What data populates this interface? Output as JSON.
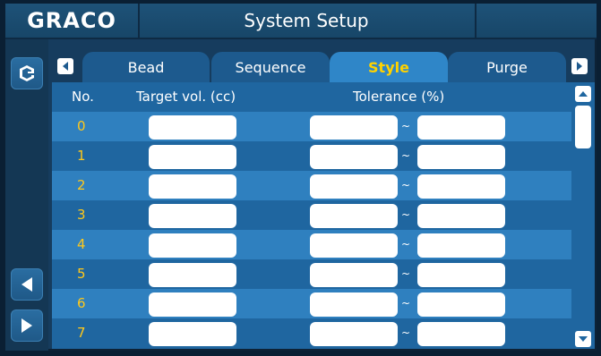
{
  "header": {
    "logo": "GRACO",
    "title": "System Setup"
  },
  "tabs": [
    {
      "label": "Bead",
      "active": false
    },
    {
      "label": "Sequence",
      "active": false
    },
    {
      "label": "Style",
      "active": true
    },
    {
      "label": "Purge",
      "active": false
    }
  ],
  "table": {
    "col_no": "No.",
    "col_target": "Target vol.  (cc)",
    "col_tolerance": "Tolerance  (%)",
    "separator": "~",
    "rows": [
      {
        "no": "0",
        "target": "",
        "tol_min": "",
        "tol_max": ""
      },
      {
        "no": "1",
        "target": "",
        "tol_min": "",
        "tol_max": ""
      },
      {
        "no": "2",
        "target": "",
        "tol_min": "",
        "tol_max": ""
      },
      {
        "no": "3",
        "target": "",
        "tol_min": "",
        "tol_max": ""
      },
      {
        "no": "4",
        "target": "",
        "tol_min": "",
        "tol_max": ""
      },
      {
        "no": "5",
        "target": "",
        "tol_min": "",
        "tol_max": ""
      },
      {
        "no": "6",
        "target": "",
        "tol_min": "",
        "tol_max": ""
      },
      {
        "no": "7",
        "target": "",
        "tol_min": "",
        "tol_max": ""
      }
    ]
  },
  "icons": {
    "home": "graco-home-icon",
    "prev": "arrow-left-icon",
    "next": "arrow-right-icon",
    "tab_left": "tab-scroll-left-icon",
    "tab_right": "tab-scroll-right-icon",
    "scroll_up": "scroll-up-icon",
    "scroll_down": "scroll-down-icon"
  },
  "colors": {
    "active_tab_text": "#ffd200",
    "row_number": "#ffc81a",
    "active_tab_bg": "#2f86c8",
    "row_stripe": "#2f80bf"
  }
}
